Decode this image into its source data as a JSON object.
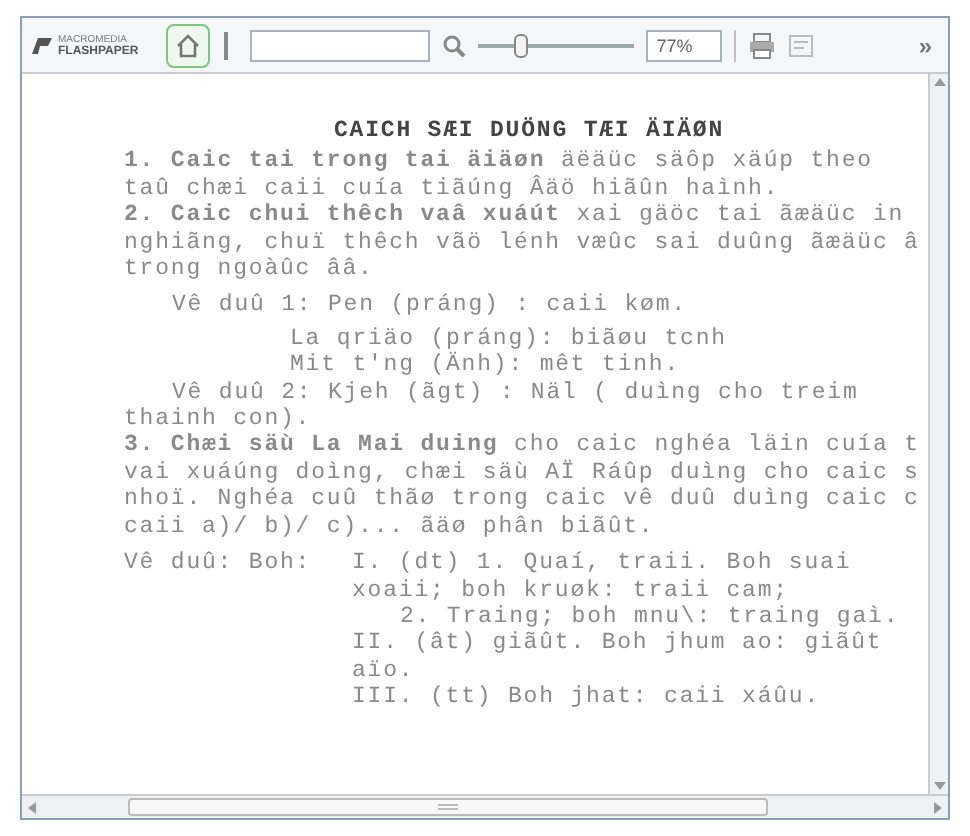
{
  "toolbar": {
    "logo_top": "MACROMEDIA",
    "logo_bottom": "FLASHPAPER",
    "zoom_slider": {
      "level": 0.25
    },
    "zoom_field": {
      "value": "77%"
    },
    "overflow": "»"
  },
  "document": {
    "title": "CAICH SÆI DUÖNG TÆI ÄIÄØN",
    "lines": [
      {
        "kind": "body",
        "text": "**1. Caic tai trong tai äiäøn** äëäüc säôp xäúp theo"
      },
      {
        "kind": "body",
        "text": "taû chæi caii cuía tiãúng Âäö hiãûn haình."
      },
      {
        "kind": "body",
        "text": "**2. Caic chui thêch vaâ xuáút** xai gäöc tai ãæäüc in"
      },
      {
        "kind": "body",
        "text": "nghiãng, chuï thêch vãö lénh væûc sai duûng ãæäüc â"
      },
      {
        "kind": "body",
        "text": "trong ngoàûc ââ."
      },
      {
        "kind": "gap",
        "text": "Vê duû 1:     Pen (práng) : caii køm."
      },
      {
        "kind": "deep",
        "text": "La qriäo (práng): biãøu tcnh"
      },
      {
        "kind": "deep",
        "text": "Mit t'ng (Änh): mêt tinh."
      },
      {
        "kind": "indent",
        "text": "Vê duû 2: Kjeh (ãgt) :  Näl ( duìng cho treim"
      },
      {
        "kind": "body",
        "text": "thainh con)."
      },
      {
        "kind": "body",
        "text": "**3. Chæi säù La Mai duing** cho caic nghéa läin cuía t"
      },
      {
        "kind": "body",
        "text": "vai xuáúng doìng, chæi säù AÏ Ráûp duìng cho caic s"
      },
      {
        "kind": "body",
        "text": "nhoï. Nghéa cuû thãø trong caic vê duû duìng caic c"
      },
      {
        "kind": "body",
        "text": "caii a)/ b)/ c)... ãäø phân biãût."
      }
    ],
    "example": {
      "label": "Vê duû: Boh:",
      "lines": [
        {
          "kind": "body",
          "text": "I. (dt)     1. Quaí, traii. Boh suai"
        },
        {
          "kind": "body",
          "text": "xoaii; boh kruøk: traii cam;"
        },
        {
          "kind": "indent",
          "text": "2. Traing; boh mnu\\: traing gaì."
        },
        {
          "kind": "body",
          "text": "II. (ât) giãût. Boh jhum ao: giãût"
        },
        {
          "kind": "body",
          "text": "aïo."
        },
        {
          "kind": "body",
          "text": "III. (tt) Boh jhat: caii xáûu."
        }
      ]
    }
  }
}
